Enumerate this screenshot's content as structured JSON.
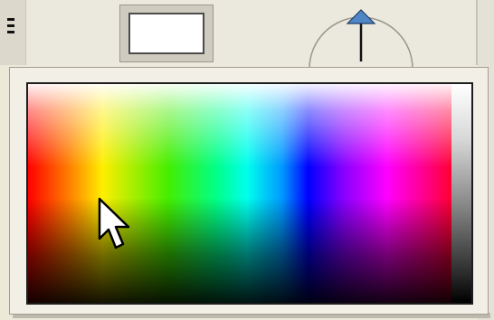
{
  "toolbar": {
    "grip_icon": "grip-icon",
    "color_swatch": {
      "icon": "color-swatch-icon",
      "current_color": "#ffffff"
    },
    "angle_dial": {
      "icon": "angle-dial-icon",
      "marker_color": "#4f86c6"
    }
  },
  "color_picker": {
    "field_icon": "color-spectrum-field",
    "grayscale_strip": "grayscale-strip",
    "cursor_icon": "arrow-cursor-icon"
  },
  "colors": {
    "toolbar_bg": "#ebe8de",
    "popup_bg": "#f1efe6",
    "border": "#1e1e1e"
  }
}
